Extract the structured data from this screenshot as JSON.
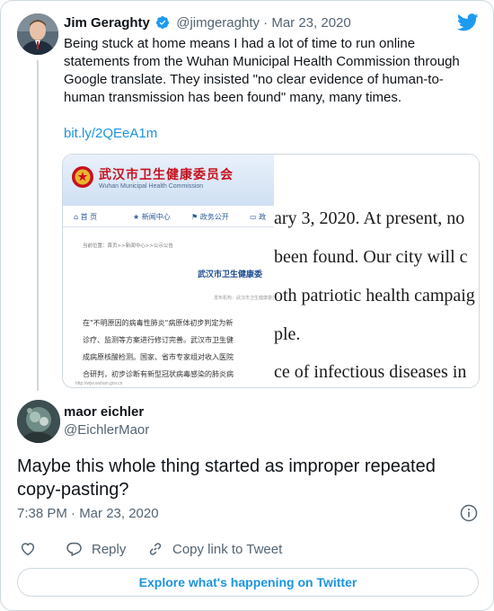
{
  "brand_color": "#1d9bf0",
  "quoted_tweet": {
    "author_name": "Jim Geraghty",
    "verified": true,
    "handle": "@jimgeraghty",
    "separator": "·",
    "date": "Mar 23, 2020",
    "text": "Being stuck at home means I had a lot of time to run online statements from the Wuhan Municipal Health Commission through Google translate. They insisted \"no clear evidence of human-to-human transmission has been found\" many, many times.",
    "link": "bit.ly/2QEeA1m",
    "image": {
      "site_title": "武汉市卫生健康委员会",
      "site_subtitle": "Wuhan Municipal Health Commission",
      "nav": [
        "首 页",
        "新闻中心",
        "政务公开",
        "政"
      ],
      "breadcrumb": "当前位置：首页>>新闻中心>>公示公告",
      "page_title": "武汉市卫生健康委",
      "meta": "发布机构：武汉市卫生健康委员会",
      "chinese_lines": [
        "在\"不明原因的病毒性肺炎\"病原体初步判定为新",
        "诊疗、监测等方案进行修订完善。武汉市卫生健",
        "成病原核酸检测。国家、省市专家组对收入医院",
        "合研判，初步诊断有新型冠状病毒感染的肺炎病"
      ],
      "footer": "http://wjw.wuhan.gov.cn",
      "english_lines": [
        "ary 3, 2020. At present, no",
        "been found. Our city will c",
        "oth patriotic health campaig",
        "ple.",
        "ce of infectious diseases in"
      ]
    }
  },
  "tweet": {
    "author_name": "maor eichler",
    "handle": "@EichlerMaor",
    "text": "Maybe this whole thing started as improper repeated copy-pasting?",
    "timestamp": "7:38 PM · Mar 23, 2020"
  },
  "actions": {
    "reply_label": "Reply",
    "copy_link_label": "Copy link to Tweet"
  },
  "explore_label": "Explore what's happening on Twitter"
}
